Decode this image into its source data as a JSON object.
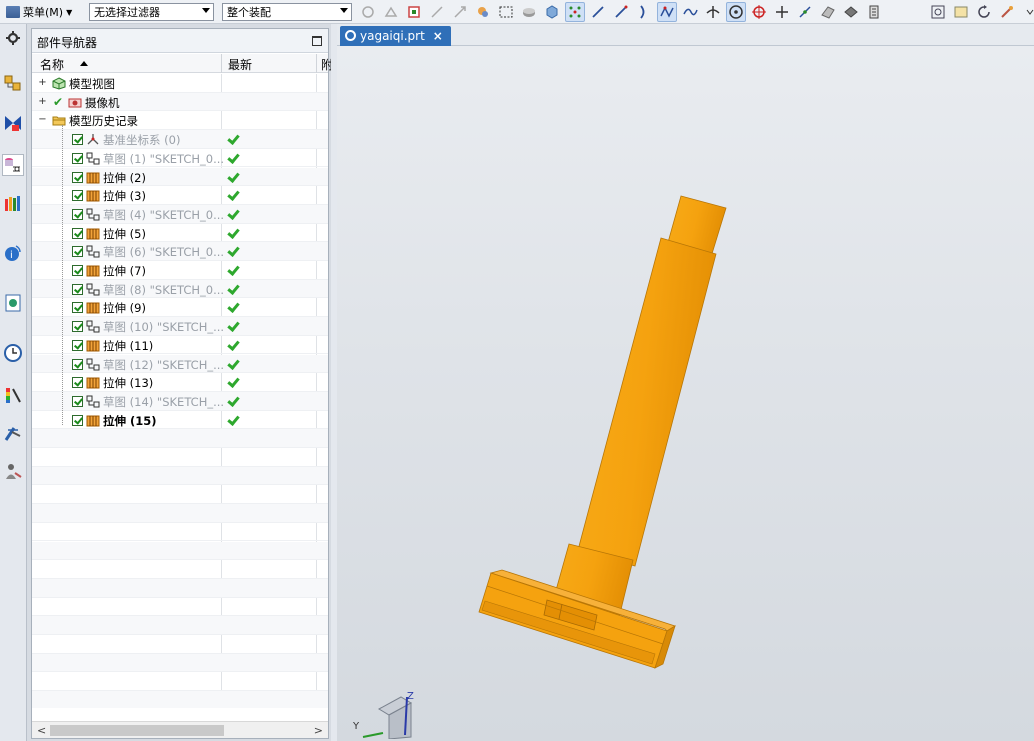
{
  "toolbar": {
    "menu_label": "菜单(M)",
    "filter_combo": "无选择过滤器",
    "assembly_combo": "整个装配"
  },
  "navigator": {
    "title": "部件导航器",
    "columns": {
      "name": "名称",
      "latest": "最新",
      "extra": "附"
    },
    "rows": [
      {
        "label": "模型视图",
        "indent": 0,
        "expander": "+",
        "kind": "views",
        "dim": false,
        "bold": false,
        "checked": false,
        "latest": false
      },
      {
        "label": "摄像机",
        "indent": 0,
        "expander": "+",
        "kind": "camera",
        "dim": false,
        "bold": false,
        "checked": false,
        "latest": false
      },
      {
        "label": "模型历史记录",
        "indent": 0,
        "expander": "-",
        "kind": "folder",
        "dim": false,
        "bold": false,
        "checked": false,
        "latest": false
      },
      {
        "label": "基准坐标系 (0)",
        "indent": 1,
        "kind": "datum",
        "dim": true,
        "bold": false,
        "checked": true,
        "latest": true
      },
      {
        "label": "草图 (1) \"SKETCH_0...",
        "indent": 1,
        "kind": "sketch",
        "dim": true,
        "bold": false,
        "checked": true,
        "latest": true
      },
      {
        "label": "拉伸 (2)",
        "indent": 1,
        "kind": "extrude",
        "dim": false,
        "bold": false,
        "checked": true,
        "latest": true
      },
      {
        "label": "拉伸 (3)",
        "indent": 1,
        "kind": "extrude",
        "dim": false,
        "bold": false,
        "checked": true,
        "latest": true
      },
      {
        "label": "草图 (4) \"SKETCH_0...",
        "indent": 1,
        "kind": "sketch",
        "dim": true,
        "bold": false,
        "checked": true,
        "latest": true
      },
      {
        "label": "拉伸 (5)",
        "indent": 1,
        "kind": "extrude",
        "dim": false,
        "bold": false,
        "checked": true,
        "latest": true
      },
      {
        "label": "草图 (6) \"SKETCH_0...",
        "indent": 1,
        "kind": "sketch",
        "dim": true,
        "bold": false,
        "checked": true,
        "latest": true
      },
      {
        "label": "拉伸 (7)",
        "indent": 1,
        "kind": "extrude",
        "dim": false,
        "bold": false,
        "checked": true,
        "latest": true
      },
      {
        "label": "草图 (8) \"SKETCH_0...",
        "indent": 1,
        "kind": "sketch",
        "dim": true,
        "bold": false,
        "checked": true,
        "latest": true
      },
      {
        "label": "拉伸 (9)",
        "indent": 1,
        "kind": "extrude",
        "dim": false,
        "bold": false,
        "checked": true,
        "latest": true
      },
      {
        "label": "草图 (10) \"SKETCH_...",
        "indent": 1,
        "kind": "sketch",
        "dim": true,
        "bold": false,
        "checked": true,
        "latest": true
      },
      {
        "label": "拉伸 (11)",
        "indent": 1,
        "kind": "extrude",
        "dim": false,
        "bold": false,
        "checked": true,
        "latest": true
      },
      {
        "label": "草图 (12) \"SKETCH_...",
        "indent": 1,
        "kind": "sketch",
        "dim": true,
        "bold": false,
        "checked": true,
        "latest": true
      },
      {
        "label": "拉伸 (13)",
        "indent": 1,
        "kind": "extrude",
        "dim": false,
        "bold": false,
        "checked": true,
        "latest": true
      },
      {
        "label": "草图 (14) \"SKETCH_...",
        "indent": 1,
        "kind": "sketch",
        "dim": true,
        "bold": false,
        "checked": true,
        "latest": true
      },
      {
        "label": "拉伸 (15)",
        "indent": 1,
        "kind": "extrude",
        "dim": false,
        "bold": true,
        "checked": true,
        "latest": true
      }
    ]
  },
  "graphics": {
    "tab_label": "yagaiqi.prt",
    "triad_z": "Z",
    "triad_y": "Y",
    "part_color": "#f5a20f",
    "part_shade": "#d88a06"
  }
}
